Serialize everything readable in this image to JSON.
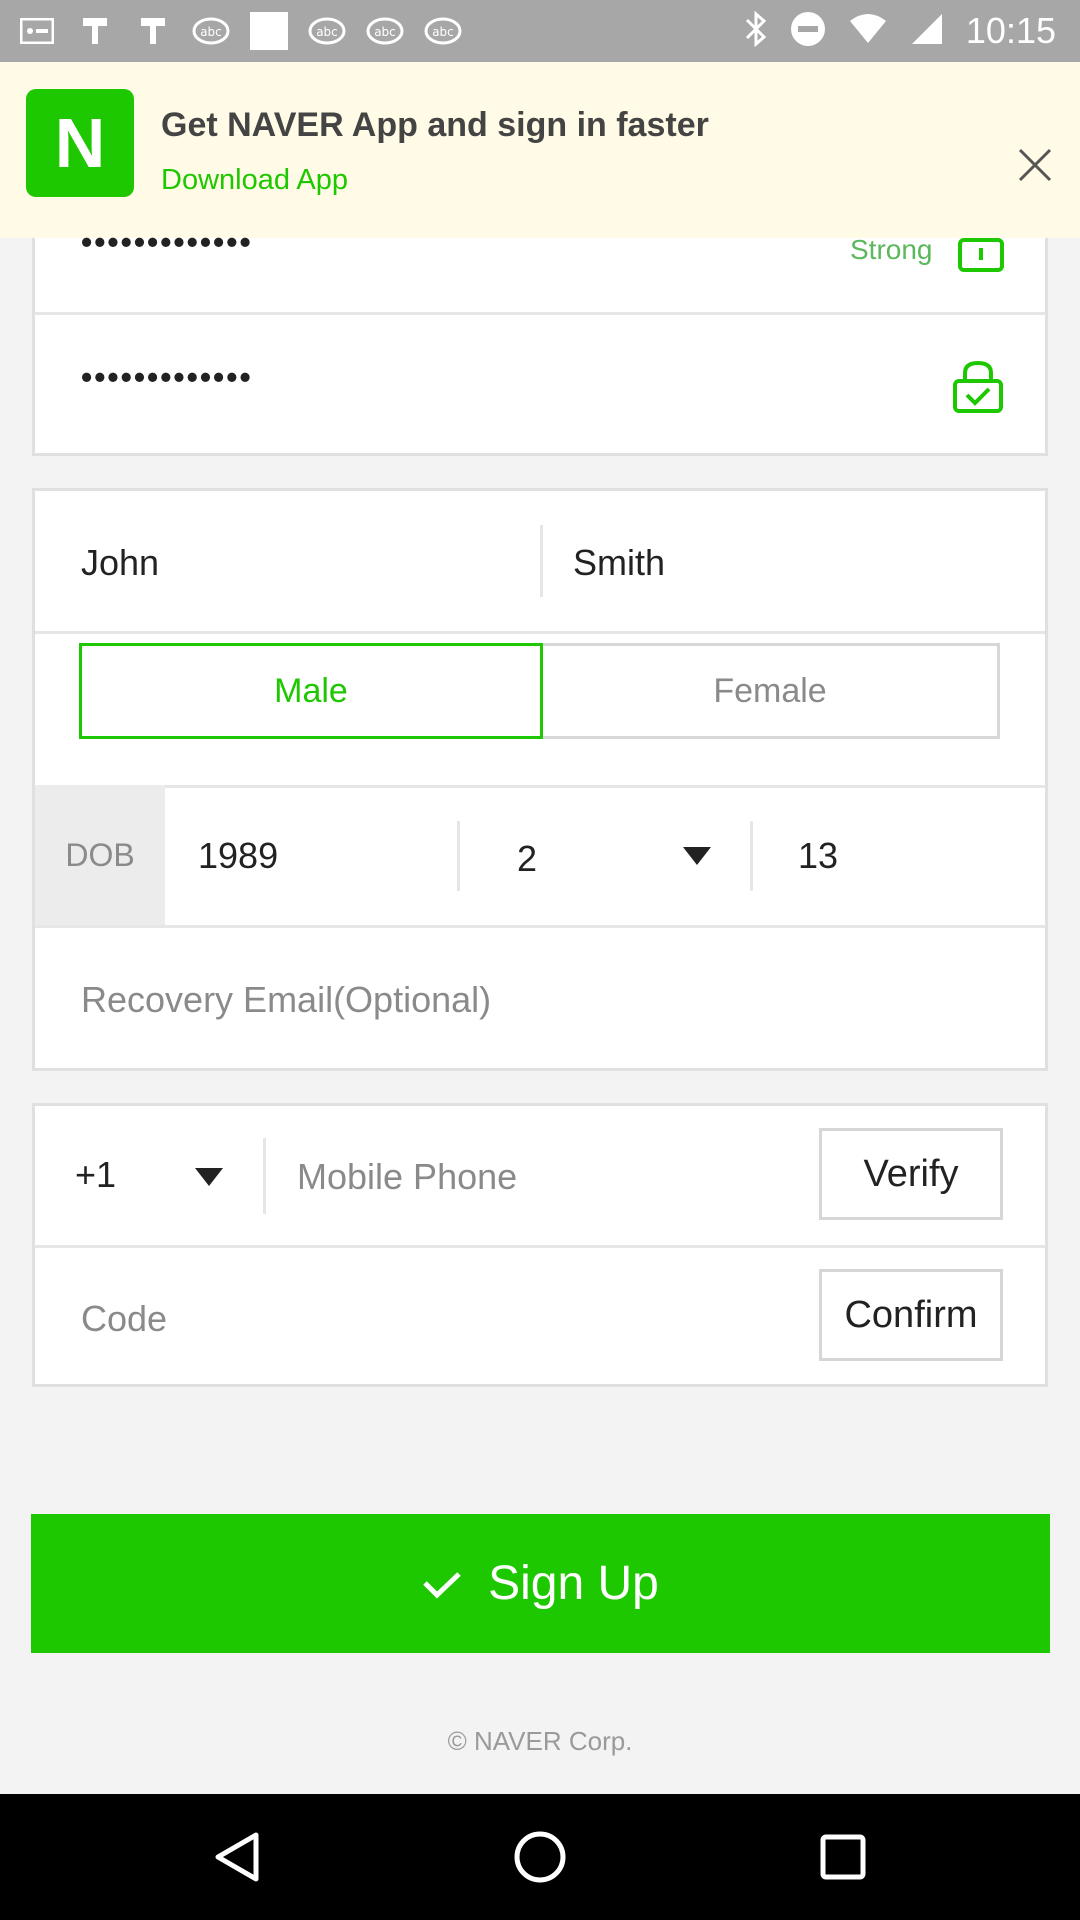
{
  "status_bar": {
    "time": "10:15",
    "left_icons": [
      "notification-icon",
      "notification-icon",
      "notification-icon",
      "abc-icon",
      "image-icon",
      "abc-icon",
      "abc-icon",
      "abc-icon"
    ],
    "right_icons": [
      "bluetooth-icon",
      "do-not-disturb-icon",
      "wifi-icon",
      "signal-icon"
    ]
  },
  "banner": {
    "logo_letter": "N",
    "title": "Get NAVER App and sign in faster",
    "link": "Download App"
  },
  "password": {
    "masked_value": "•••••••••••••",
    "strength_label": "Strong",
    "confirm_masked_value": "•••••••••••••"
  },
  "name": {
    "first": "John",
    "last": "Smith"
  },
  "gender": {
    "male_label": "Male",
    "female_label": "Female",
    "selected": "Male"
  },
  "dob": {
    "label": "DOB",
    "year": "1989",
    "month": "2",
    "day": "13"
  },
  "recovery_email": {
    "placeholder": "Recovery Email(Optional)"
  },
  "phone": {
    "country_code": "+1",
    "placeholder": "Mobile Phone",
    "verify_label": "Verify",
    "code_placeholder": "Code",
    "confirm_label": "Confirm"
  },
  "signup_label": "Sign Up",
  "copyright": "© NAVER Corp.",
  "colors": {
    "accent": "#1ec800",
    "banner_bg": "#fffbe6"
  }
}
